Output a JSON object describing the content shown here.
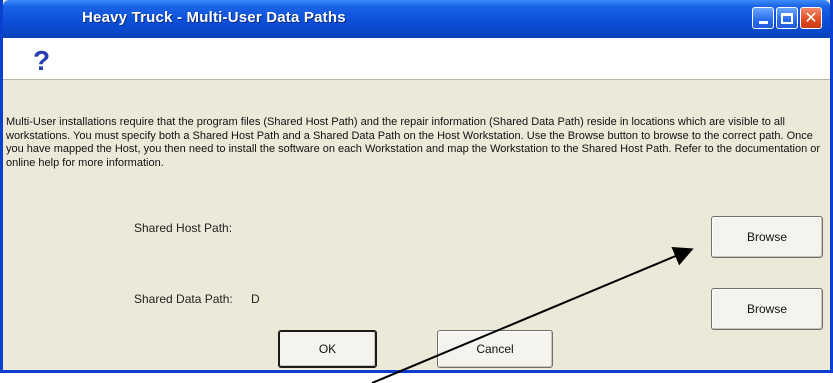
{
  "window": {
    "title": "Heavy Truck - Multi-User Data Paths",
    "controls": {
      "minimize": "minimize-icon",
      "maximize": "maximize-icon",
      "close": "close-icon"
    }
  },
  "header": {
    "icon_glyph": "?"
  },
  "message": "Multi-User installations require that the program files (Shared Host Path) and the repair information (Shared Data Path) reside in locations which are visible to all workstations.  You must specify both a Shared Host Path and a Shared Data Path on the Host Workstation.  Use the Browse button to browse to the correct path.  Once you have mapped the Host, you then need to install the software on each Workstation and map the Workstation to the Shared Host Path.  Refer to the documentation or online help for more information.",
  "fields": {
    "host": {
      "label": "Shared Host Path:",
      "value": ""
    },
    "data": {
      "label": "Shared Data Path:",
      "value": "D"
    }
  },
  "buttons": {
    "browse_host": "Browse",
    "browse_data": "Browse",
    "ok": "OK",
    "cancel": "Cancel"
  },
  "colors": {
    "titlebar": "#0b4fd8",
    "window_border": "#0a3fd0",
    "dialog_bg": "#ece9d8",
    "question": "#2a3fb0",
    "close_button": "#e04a20"
  }
}
